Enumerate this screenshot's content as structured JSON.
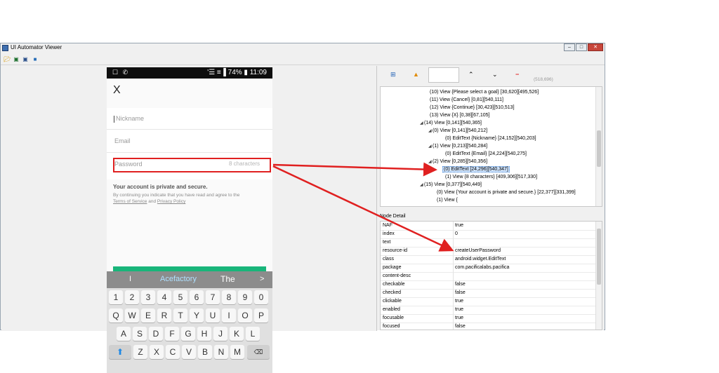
{
  "window": {
    "title": "UI Automator Viewer",
    "controls": [
      "–",
      "□",
      "✕"
    ]
  },
  "toolbar": {
    "icons": [
      "open-icon",
      "device-screenshot-icon",
      "compressed-screenshot-icon",
      "save-icon"
    ]
  },
  "phone": {
    "status_left": "☐ ✆",
    "status_right": "'☰ ≡▐ 74% ▮ 11:09",
    "close_label": "X",
    "fields": [
      {
        "placeholder": "Nickname"
      },
      {
        "placeholder": "Email"
      },
      {
        "placeholder": "Password",
        "counter": "8 characters"
      }
    ],
    "privacy_title": "Your account is private and secure.",
    "privacy_line1": "By continuing you indicate that you have read and agree to the",
    "privacy_terms": "Terms of Service",
    "privacy_and": "and",
    "privacy_policy": "Privacy Policy",
    "suggestions": [
      "I",
      "Acefactory",
      "The",
      ">"
    ],
    "keys_row1": [
      "1",
      "2",
      "3",
      "4",
      "5",
      "6",
      "7",
      "8",
      "9",
      "0"
    ],
    "keys_row2": [
      "Q",
      "W",
      "E",
      "R",
      "T",
      "Y",
      "U",
      "I",
      "O",
      "P"
    ],
    "keys_row3": [
      "A",
      "S",
      "D",
      "F",
      "G",
      "H",
      "J",
      "K",
      "L"
    ],
    "keys_row4": [
      "Z",
      "X",
      "C",
      "V",
      "B",
      "N",
      "M"
    ],
    "del_label": "⌫",
    "shift_label": "⬆"
  },
  "right_toolbar": {
    "coords": "(518,696)"
  },
  "tree": {
    "rows": [
      {
        "indent": 0,
        "expander": "",
        "label": "(10) View {Please select a goal} [30,620][495,526]"
      },
      {
        "indent": 0,
        "expander": "",
        "label": "(11) View {Cancel} [0,81][540,111]"
      },
      {
        "indent": 0,
        "expander": "",
        "label": "(12) View {Continue} [30,423][510,513]"
      },
      {
        "indent": 0,
        "expander": "",
        "label": "(13) View {X} [0,38][67,105]"
      },
      {
        "indent": 0,
        "expander": "◢",
        "label": "(14) View [0,141][540,365]"
      },
      {
        "indent": 1,
        "expander": "◢",
        "label": "(0) View [0,141][540,212]"
      },
      {
        "indent": 2,
        "expander": "",
        "label": "(0) EditText {Nickname} [24,152][540,203]"
      },
      {
        "indent": 1,
        "expander": "◢",
        "label": "(1) View [0,213][540,284]"
      },
      {
        "indent": 2,
        "expander": "",
        "label": "(0) EditText {Email} [24,224][540,275]"
      },
      {
        "indent": 1,
        "expander": "◢",
        "label": "(2) View [0,285][540,356]"
      },
      {
        "indent": 2,
        "expander": "",
        "label": "(0) EditText [24,296][540,347]",
        "selected": true
      },
      {
        "indent": 2,
        "expander": "",
        "label": "(1) View {8 characters} [409,306][517,330]"
      },
      {
        "indent": 0,
        "expander": "◢",
        "label": "(15) View [0,377][540,449]"
      },
      {
        "indent": 1,
        "expander": "",
        "label": "(0) View {Your account is private and secure.} [22,377][331,399]"
      },
      {
        "indent": 1,
        "expander": "",
        "label": "(1) View {"
      }
    ]
  },
  "node_detail": {
    "title": "Node Detail",
    "rows": [
      {
        "key": "NAF",
        "value": "true"
      },
      {
        "key": "index",
        "value": "0"
      },
      {
        "key": "text",
        "value": ""
      },
      {
        "key": "resource-id",
        "value": "createUserPassword"
      },
      {
        "key": "class",
        "value": "android.widget.EditText"
      },
      {
        "key": "package",
        "value": "com.pacificalabs.pacifica"
      },
      {
        "key": "content-desc",
        "value": ""
      },
      {
        "key": "checkable",
        "value": "false"
      },
      {
        "key": "checked",
        "value": "false"
      },
      {
        "key": "clickable",
        "value": "true"
      },
      {
        "key": "enabled",
        "value": "true"
      },
      {
        "key": "focusable",
        "value": "true"
      },
      {
        "key": "focused",
        "value": "false"
      }
    ]
  },
  "colors": {
    "arrow": "#e02020",
    "green_button": "#18b57a",
    "suggestion_highlight": "#4aa3ff"
  }
}
